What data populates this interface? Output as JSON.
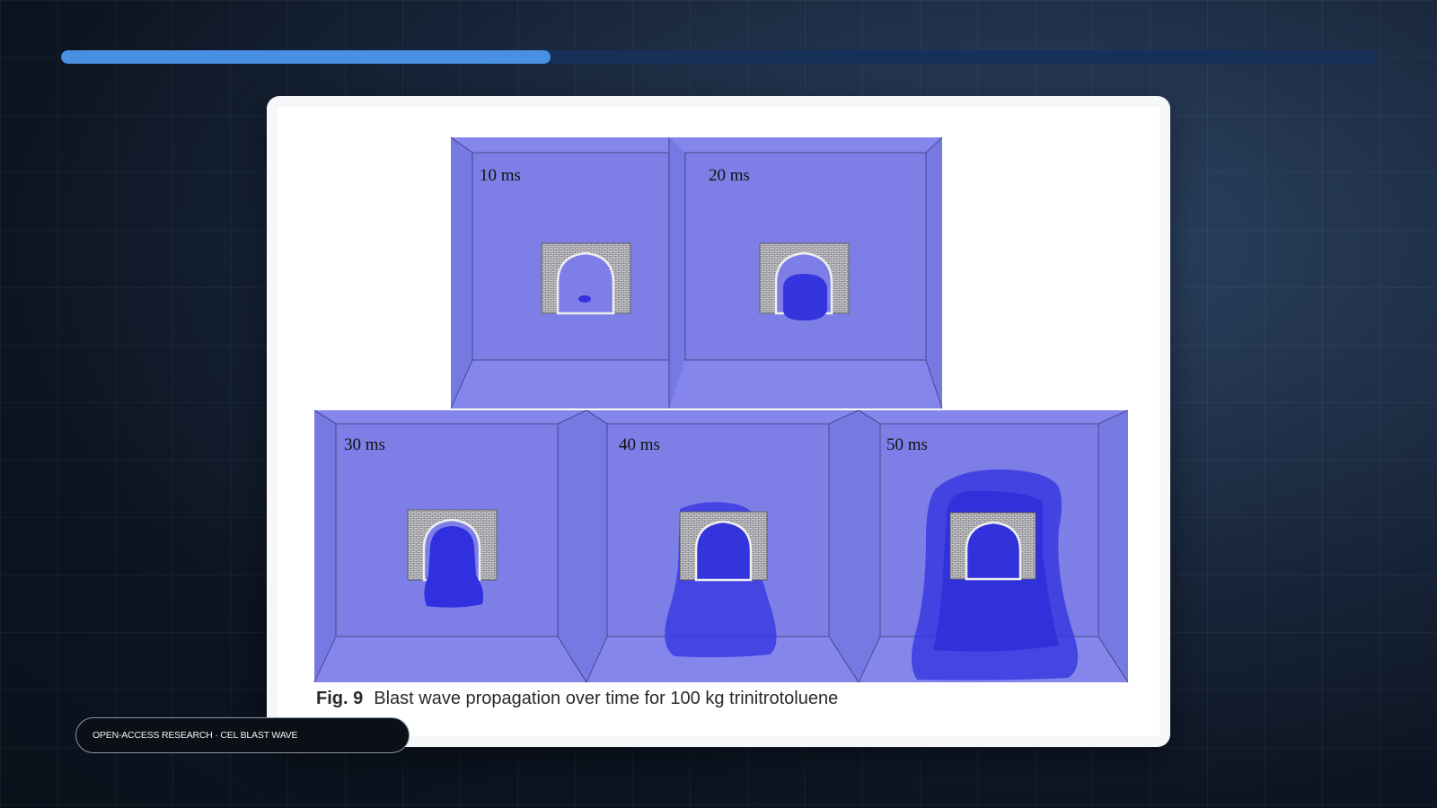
{
  "progress": {
    "fraction": 0.372
  },
  "figure": {
    "fig_label": "Fig. 9",
    "caption": "Blast wave propagation over time for 100 kg trinitrotoluene",
    "panels": [
      {
        "label": "10 ms"
      },
      {
        "label": "20 ms"
      },
      {
        "label": "30 ms"
      },
      {
        "label": "40 ms"
      },
      {
        "label": "50 ms"
      }
    ]
  },
  "badge": {
    "text": "OPEN-ACCESS RESEARCH · CEL BLAST WAVE"
  },
  "colors": {
    "progress_fill": "#4a90e2",
    "progress_track": "#16305a",
    "box_back": "#7e80e6",
    "box_side": "#7476e0",
    "blast": "#2f2fe0"
  }
}
